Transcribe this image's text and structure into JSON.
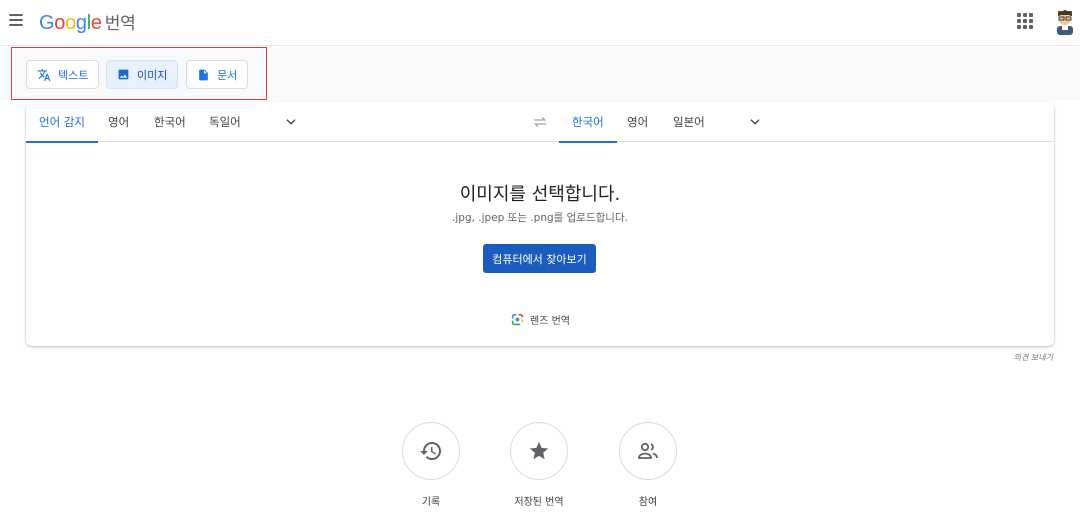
{
  "header": {
    "logo_letters": [
      {
        "ch": "G",
        "color": "#4285F4"
      },
      {
        "ch": "o",
        "color": "#EA4335"
      },
      {
        "ch": "o",
        "color": "#FBBC05"
      },
      {
        "ch": "g",
        "color": "#4285F4"
      },
      {
        "ch": "l",
        "color": "#34A853"
      },
      {
        "ch": "e",
        "color": "#EA4335"
      }
    ],
    "product": "번역",
    "menu_icon": "hamburger-icon",
    "apps_icon": "apps-grid-icon"
  },
  "modes": {
    "text": "텍스트",
    "image": "이미지",
    "document": "문서",
    "active": "image"
  },
  "source_langs": {
    "detect": "언어 감지",
    "items": [
      "영어",
      "한국어",
      "독일어"
    ]
  },
  "target_langs": {
    "items": [
      "한국어",
      "영어",
      "일본어"
    ]
  },
  "drop": {
    "title": "이미지를 선택합니다.",
    "subtitle": ".jpg, .jpep 또는 .png를 업로드합니다.",
    "browse": "컴퓨터에서 찾아보기",
    "lens": "렌즈 번역"
  },
  "feedback": "의견 보내기",
  "actions": {
    "history": "기록",
    "saved": "저장된 번역",
    "contribute": "참여"
  },
  "colors": {
    "accent": "#1a73e8",
    "highlight_border": "#e53935",
    "button_bg": "#1a5dbf"
  }
}
